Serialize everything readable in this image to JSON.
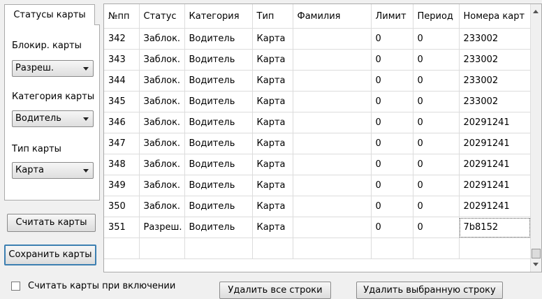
{
  "left_panel": {
    "tab_label": "Статусы карты",
    "block_label": "Блокир. карты",
    "block_value": "Разреш.",
    "category_label": "Категория карты",
    "category_value": "Водитель",
    "type_label": "Тип карты",
    "type_value": "Карта",
    "read_button": "Считать карты",
    "save_button": "Сохранить карты"
  },
  "grid": {
    "headers": [
      "№пп",
      "Статус",
      "Категория",
      "Тип",
      "Фамилия",
      "Лимит",
      "Период",
      "Номера карт"
    ],
    "rows": [
      [
        "342",
        "Заблок.",
        "Водитель",
        "Карта",
        "",
        "0",
        "0",
        "233002"
      ],
      [
        "343",
        "Заблок.",
        "Водитель",
        "Карта",
        "",
        "0",
        "0",
        "233002"
      ],
      [
        "344",
        "Заблок.",
        "Водитель",
        "Карта",
        "",
        "0",
        "0",
        "233002"
      ],
      [
        "345",
        "Заблок.",
        "Водитель",
        "Карта",
        "",
        "0",
        "0",
        "233002"
      ],
      [
        "346",
        "Заблок.",
        "Водитель",
        "Карта",
        "",
        "0",
        "0",
        "20291241"
      ],
      [
        "347",
        "Заблок.",
        "Водитель",
        "Карта",
        "",
        "0",
        "0",
        "20291241"
      ],
      [
        "348",
        "Заблок.",
        "Водитель",
        "Карта",
        "",
        "0",
        "0",
        "20291241"
      ],
      [
        "349",
        "Заблок.",
        "Водитель",
        "Карта",
        "",
        "0",
        "0",
        "20291241"
      ],
      [
        "350",
        "Заблок.",
        "Водитель",
        "Карта",
        "",
        "0",
        "0",
        "20291241"
      ],
      [
        "351",
        "Разреш.",
        "Водитель",
        "Карта",
        "",
        "0",
        "0",
        "7b8152"
      ]
    ]
  },
  "bottom": {
    "checkbox_label": "Считать карты при включении",
    "delete_all_button": "Удалить все строки",
    "delete_selected_button": "Удалить выбранную строку"
  }
}
